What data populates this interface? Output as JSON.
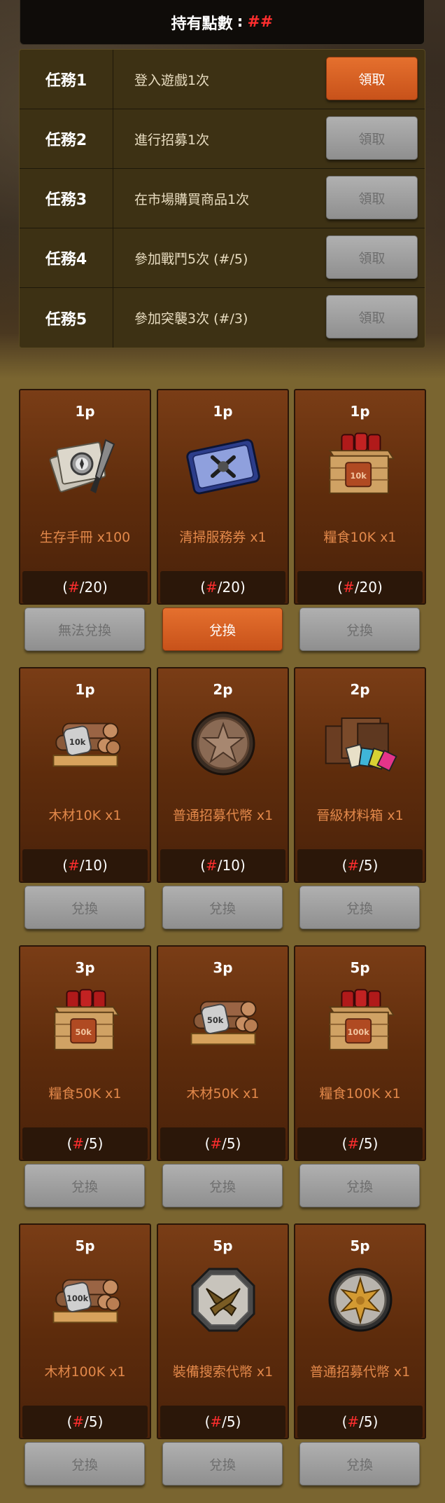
{
  "header": {
    "label": "持有點數",
    "separator": ":",
    "points": "##"
  },
  "tasks": [
    {
      "name": "任務1",
      "desc": "登入遊戲1次",
      "button": "領取",
      "active": true
    },
    {
      "name": "任務2",
      "desc": "進行招募1次",
      "button": "領取",
      "active": false
    },
    {
      "name": "任務3",
      "desc": "在市場購買商品1次",
      "button": "領取",
      "active": false
    },
    {
      "name": "任務4",
      "desc": "參加戰鬥5次 (#/5)",
      "button": "領取",
      "active": false
    },
    {
      "name": "任務5",
      "desc": "參加突襲3次 (#/3)",
      "button": "領取",
      "active": false
    }
  ],
  "rewards": [
    {
      "cost": "1p",
      "icon": "survival-manual-icon",
      "name": "生存手冊 x100",
      "count_open": "(",
      "count_hash": "#",
      "count_rest": "/20)",
      "button": "無法兌換",
      "active": false
    },
    {
      "cost": "1p",
      "icon": "sweep-ticket-icon",
      "name": "清掃服務券 x1",
      "count_open": "(",
      "count_hash": "#",
      "count_rest": "/20)",
      "button": "兌換",
      "active": true
    },
    {
      "cost": "1p",
      "icon": "food-crate-10k-icon",
      "name": "糧食10K x1",
      "count_open": "(",
      "count_hash": "#",
      "count_rest": "/20)",
      "button": "兌換",
      "active": false
    },
    {
      "cost": "1p",
      "icon": "wood-10k-icon",
      "name": "木材10K x1",
      "count_open": "(",
      "count_hash": "#",
      "count_rest": "/10)",
      "button": "兌換",
      "active": false
    },
    {
      "cost": "2p",
      "icon": "star-token-icon",
      "name": "普通招募代幣 x1",
      "count_open": "(",
      "count_hash": "#",
      "count_rest": "/10)",
      "button": "兌換",
      "active": false
    },
    {
      "cost": "2p",
      "icon": "material-box-icon",
      "name": "晉級材料箱 x1",
      "count_open": "(",
      "count_hash": "#",
      "count_rest": "/5)",
      "button": "兌換",
      "active": false
    },
    {
      "cost": "3p",
      "icon": "food-crate-50k-icon",
      "name": "糧食50K x1",
      "count_open": "(",
      "count_hash": "#",
      "count_rest": "/5)",
      "button": "兌換",
      "active": false
    },
    {
      "cost": "3p",
      "icon": "wood-50k-icon",
      "name": "木材50K x1",
      "count_open": "(",
      "count_hash": "#",
      "count_rest": "/5)",
      "button": "兌換",
      "active": false
    },
    {
      "cost": "5p",
      "icon": "food-crate-100k-icon",
      "name": "糧食100K x1",
      "count_open": "(",
      "count_hash": "#",
      "count_rest": "/5)",
      "button": "兌換",
      "active": false
    },
    {
      "cost": "5p",
      "icon": "wood-100k-icon",
      "name": "木材100K x1",
      "count_open": "(",
      "count_hash": "#",
      "count_rest": "/5)",
      "button": "兌換",
      "active": false
    },
    {
      "cost": "5p",
      "icon": "gun-token-icon",
      "name": "裝備搜索代幣 x1",
      "count_open": "(",
      "count_hash": "#",
      "count_rest": "/5)",
      "button": "兌換",
      "active": false
    },
    {
      "cost": "5p",
      "icon": "sheriff-star-token-icon",
      "name": "普通招募代幣 x1",
      "count_open": "(",
      "count_hash": "#",
      "count_rest": "/5)",
      "button": "兌換",
      "active": false
    }
  ],
  "colors": {
    "accent_orange": "#d45f22",
    "point_red": "#ff2e2e",
    "item_name": "#e2884a",
    "card_brown": "#6b3311",
    "disabled_gray": "#9a9a9a"
  }
}
